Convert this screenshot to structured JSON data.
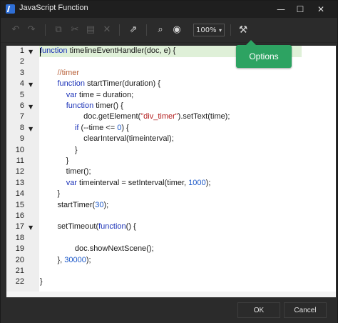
{
  "window": {
    "title": "JavaScript Function",
    "minimize": "—",
    "maximize": "☐",
    "close": "✕"
  },
  "toolbar": {
    "zoom": "100%",
    "tooltip": "Options"
  },
  "lines": [
    {
      "n": "1",
      "code": [
        {
          "t": "function",
          "c": "kw"
        },
        {
          "t": " timelineEventHandler(doc, e) {"
        }
      ]
    },
    {
      "n": "2",
      "code": []
    },
    {
      "n": "3",
      "code": [
        {
          "t": "        "
        },
        {
          "t": "//timer",
          "c": "cm"
        }
      ]
    },
    {
      "n": "4",
      "code": [
        {
          "t": "        "
        },
        {
          "t": "function",
          "c": "kw"
        },
        {
          "t": " startTimer(duration) {"
        }
      ]
    },
    {
      "n": "5",
      "code": [
        {
          "t": "            "
        },
        {
          "t": "var",
          "c": "kw"
        },
        {
          "t": " time = duration;"
        }
      ]
    },
    {
      "n": "6",
      "code": [
        {
          "t": "            "
        },
        {
          "t": "function",
          "c": "kw"
        },
        {
          "t": " timer() {"
        }
      ]
    },
    {
      "n": "7",
      "code": [
        {
          "t": "                    doc.getElement("
        },
        {
          "t": "\"div_timer\"",
          "c": "st"
        },
        {
          "t": ").setText(time);"
        }
      ]
    },
    {
      "n": "8",
      "code": [
        {
          "t": "                "
        },
        {
          "t": "if",
          "c": "kw"
        },
        {
          "t": " (--time <= "
        },
        {
          "t": "0",
          "c": "nm"
        },
        {
          "t": ") {"
        }
      ]
    },
    {
      "n": "9",
      "code": [
        {
          "t": "                    clearInterval(timeinterval);"
        }
      ]
    },
    {
      "n": "10",
      "code": [
        {
          "t": "                }"
        }
      ]
    },
    {
      "n": "11",
      "code": [
        {
          "t": "            }"
        }
      ]
    },
    {
      "n": "12",
      "code": [
        {
          "t": "            timer();"
        }
      ]
    },
    {
      "n": "13",
      "code": [
        {
          "t": "            "
        },
        {
          "t": "var",
          "c": "kw"
        },
        {
          "t": " timeinterval = setInterval(timer, "
        },
        {
          "t": "1000",
          "c": "nm"
        },
        {
          "t": ");"
        }
      ]
    },
    {
      "n": "14",
      "code": [
        {
          "t": "        }"
        }
      ]
    },
    {
      "n": "15",
      "code": [
        {
          "t": "        startTimer("
        },
        {
          "t": "30",
          "c": "nm"
        },
        {
          "t": ");"
        }
      ]
    },
    {
      "n": "16",
      "code": []
    },
    {
      "n": "17",
      "code": [
        {
          "t": "        setTimeout("
        },
        {
          "t": "function",
          "c": "kw"
        },
        {
          "t": "() {"
        }
      ]
    },
    {
      "n": "18",
      "code": []
    },
    {
      "n": "19",
      "code": [
        {
          "t": "                doc.showNextScene();"
        }
      ]
    },
    {
      "n": "20",
      "code": [
        {
          "t": "        }, "
        },
        {
          "t": "30000",
          "c": "nm"
        },
        {
          "t": ");"
        }
      ]
    },
    {
      "n": "21",
      "code": []
    },
    {
      "n": "22",
      "code": [
        {
          "t": "}"
        }
      ]
    }
  ],
  "fold_lines": [
    "1",
    "4",
    "6",
    "8",
    "17"
  ],
  "footer": {
    "ok": "OK",
    "cancel": "Cancel"
  }
}
